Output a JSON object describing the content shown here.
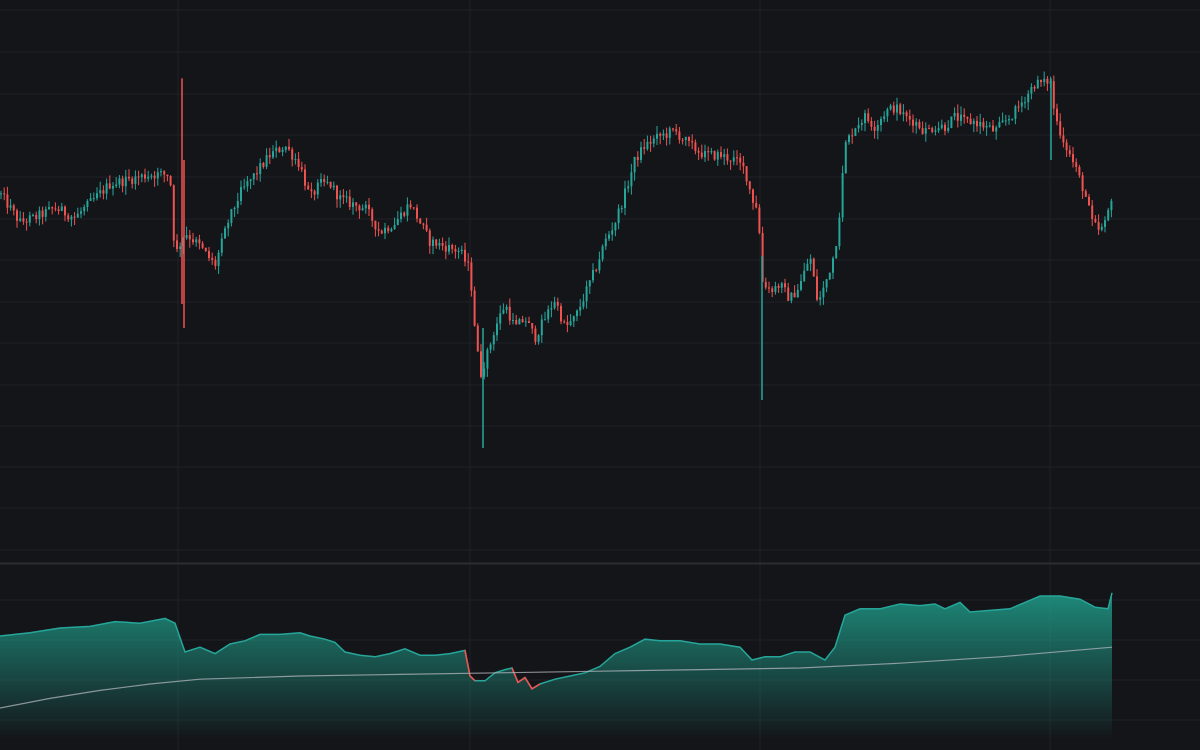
{
  "colors": {
    "background": "#141519",
    "grid": "#1f2126",
    "separator": "#2b2d33",
    "up": "#26a69a",
    "down": "#ef5350",
    "baseline": "#b2b5be",
    "area_top": "#1f9e8a"
  },
  "chart_data": [
    {
      "type": "candlestick",
      "title": "",
      "xlabel": "",
      "ylabel": "",
      "grid": true,
      "ylim": [
        0,
        100
      ],
      "anchors": [
        [
          0,
          68
        ],
        [
          10,
          65
        ],
        [
          20,
          62
        ],
        [
          35,
          63
        ],
        [
          55,
          65
        ],
        [
          75,
          63
        ],
        [
          90,
          66
        ],
        [
          110,
          70
        ],
        [
          130,
          71
        ],
        [
          150,
          72
        ],
        [
          170,
          72
        ],
        [
          175,
          55
        ],
        [
          185,
          60
        ],
        [
          200,
          57
        ],
        [
          215,
          53
        ],
        [
          228,
          62
        ],
        [
          240,
          68
        ],
        [
          255,
          72
        ],
        [
          270,
          76
        ],
        [
          285,
          78
        ],
        [
          300,
          74
        ],
        [
          310,
          67
        ],
        [
          320,
          70
        ],
        [
          330,
          70
        ],
        [
          340,
          67
        ],
        [
          350,
          66
        ],
        [
          365,
          65
        ],
        [
          380,
          60
        ],
        [
          395,
          62
        ],
        [
          410,
          66
        ],
        [
          420,
          62
        ],
        [
          430,
          58
        ],
        [
          445,
          57
        ],
        [
          460,
          56
        ],
        [
          470,
          52
        ],
        [
          475,
          40
        ],
        [
          480,
          30
        ],
        [
          488,
          35
        ],
        [
          495,
          40
        ],
        [
          505,
          45
        ],
        [
          515,
          40
        ],
        [
          525,
          42
        ],
        [
          535,
          38
        ],
        [
          545,
          42
        ],
        [
          555,
          46
        ],
        [
          565,
          40
        ],
        [
          575,
          42
        ],
        [
          585,
          47
        ],
        [
          595,
          52
        ],
        [
          605,
          58
        ],
        [
          615,
          62
        ],
        [
          625,
          68
        ],
        [
          635,
          75
        ],
        [
          645,
          78
        ],
        [
          660,
          80
        ],
        [
          675,
          81
        ],
        [
          690,
          78
        ],
        [
          705,
          76
        ],
        [
          720,
          76
        ],
        [
          735,
          75
        ],
        [
          745,
          73
        ],
        [
          752,
          67
        ],
        [
          758,
          65
        ],
        [
          762,
          50
        ],
        [
          770,
          48
        ],
        [
          780,
          49
        ],
        [
          790,
          46
        ],
        [
          800,
          49
        ],
        [
          810,
          55
        ],
        [
          818,
          45
        ],
        [
          825,
          49
        ],
        [
          835,
          56
        ],
        [
          840,
          65
        ],
        [
          845,
          78
        ],
        [
          855,
          82
        ],
        [
          865,
          84
        ],
        [
          875,
          82
        ],
        [
          885,
          85
        ],
        [
          895,
          86
        ],
        [
          905,
          84
        ],
        [
          915,
          83
        ],
        [
          925,
          81
        ],
        [
          935,
          82
        ],
        [
          945,
          82
        ],
        [
          955,
          84
        ],
        [
          965,
          83
        ],
        [
          975,
          83
        ],
        [
          985,
          82
        ],
        [
          995,
          81
        ],
        [
          1005,
          83
        ],
        [
          1015,
          85
        ],
        [
          1025,
          88
        ],
        [
          1035,
          91
        ],
        [
          1045,
          91
        ],
        [
          1050,
          92
        ],
        [
          1055,
          84
        ],
        [
          1062,
          80
        ],
        [
          1070,
          76
        ],
        [
          1078,
          72
        ],
        [
          1085,
          68
        ],
        [
          1092,
          62
        ],
        [
          1100,
          60
        ],
        [
          1106,
          62
        ],
        [
          1112,
          68
        ]
      ],
      "spikes": [
        {
          "x": 182,
          "high": 92,
          "low": 45
        },
        {
          "x": 184,
          "high": 75,
          "low": 40
        },
        {
          "x": 483,
          "high": 40,
          "low": 15
        },
        {
          "x": 762,
          "high": 55,
          "low": 25
        },
        {
          "x": 1051,
          "high": 92,
          "low": 75
        }
      ]
    },
    {
      "type": "area",
      "title": "",
      "xlabel": "",
      "ylabel": "",
      "grid": true,
      "ylim": [
        0,
        100
      ],
      "area": [
        [
          0,
          65
        ],
        [
          30,
          67
        ],
        [
          60,
          70
        ],
        [
          90,
          71
        ],
        [
          115,
          74
        ],
        [
          140,
          73
        ],
        [
          165,
          76
        ],
        [
          175,
          73
        ],
        [
          185,
          55
        ],
        [
          200,
          58
        ],
        [
          215,
          54
        ],
        [
          230,
          60
        ],
        [
          245,
          62
        ],
        [
          260,
          66
        ],
        [
          280,
          66
        ],
        [
          300,
          67
        ],
        [
          310,
          65
        ],
        [
          325,
          63
        ],
        [
          335,
          61
        ],
        [
          345,
          55
        ],
        [
          360,
          53
        ],
        [
          375,
          52
        ],
        [
          390,
          54
        ],
        [
          405,
          57
        ],
        [
          420,
          53
        ],
        [
          435,
          53
        ],
        [
          450,
          54
        ],
        [
          465,
          56
        ],
        [
          470,
          40
        ],
        [
          475,
          37
        ],
        [
          485,
          37
        ],
        [
          495,
          42
        ],
        [
          505,
          44
        ],
        [
          512,
          45
        ],
        [
          518,
          36
        ],
        [
          525,
          39
        ],
        [
          532,
          32
        ],
        [
          540,
          35
        ],
        [
          555,
          38
        ],
        [
          570,
          40
        ],
        [
          585,
          42
        ],
        [
          600,
          46
        ],
        [
          615,
          54
        ],
        [
          630,
          58
        ],
        [
          645,
          63
        ],
        [
          660,
          62
        ],
        [
          680,
          62
        ],
        [
          700,
          60
        ],
        [
          720,
          60
        ],
        [
          740,
          58
        ],
        [
          752,
          50
        ],
        [
          765,
          52
        ],
        [
          780,
          52
        ],
        [
          795,
          55
        ],
        [
          810,
          55
        ],
        [
          825,
          50
        ],
        [
          835,
          58
        ],
        [
          845,
          78
        ],
        [
          860,
          82
        ],
        [
          880,
          82
        ],
        [
          900,
          85
        ],
        [
          920,
          84
        ],
        [
          935,
          85
        ],
        [
          945,
          82
        ],
        [
          960,
          86
        ],
        [
          970,
          80
        ],
        [
          990,
          81
        ],
        [
          1010,
          82
        ],
        [
          1025,
          86
        ],
        [
          1040,
          90
        ],
        [
          1060,
          90
        ],
        [
          1080,
          88
        ],
        [
          1095,
          83
        ],
        [
          1108,
          82
        ],
        [
          1112,
          92
        ]
      ],
      "baseline": [
        [
          0,
          20
        ],
        [
          50,
          26
        ],
        [
          100,
          31
        ],
        [
          150,
          35
        ],
        [
          200,
          38
        ],
        [
          300,
          40
        ],
        [
          400,
          41
        ],
        [
          500,
          42
        ],
        [
          600,
          43
        ],
        [
          700,
          44
        ],
        [
          800,
          45
        ],
        [
          900,
          48
        ],
        [
          1000,
          52
        ],
        [
          1112,
          58
        ]
      ],
      "below_baseline_segments": [
        [
          468,
          478
        ],
        [
          518,
          545
        ]
      ]
    }
  ]
}
